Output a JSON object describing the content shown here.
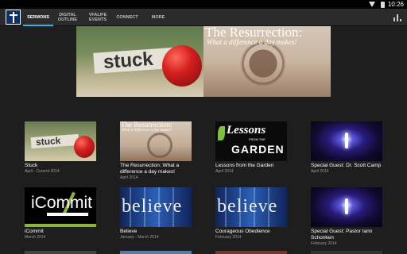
{
  "status_bar": {
    "time": "10:26"
  },
  "nav": {
    "tabs": [
      {
        "label": "SERMONS"
      },
      {
        "label": "DIGITAL OUTLINE"
      },
      {
        "label": "VFALIFE EVENTS"
      },
      {
        "label": "CONNECT"
      },
      {
        "label": "MORE"
      }
    ]
  },
  "hero": {
    "left_word": "stuck",
    "right_title": "The Resurrection:",
    "right_subtitle": "What a difference a day makes!"
  },
  "series": [
    {
      "title": "Stuck",
      "date": "April - Current 2014",
      "thumb": "stuck",
      "thumb_text": "stuck"
    },
    {
      "title": "The Resurrection: What a difference a day makes!",
      "date": "April 2014",
      "thumb": "resurrection",
      "thumb_text": "The Resurrection:",
      "thumb_sub": "What a difference a day makes!"
    },
    {
      "title": "Lessons from the Garden",
      "date": "April 2014",
      "thumb": "lessons",
      "thumb_text": "Lessons",
      "thumb_sub": "FROM THE",
      "thumb_text2": "GARDEN"
    },
    {
      "title": "Special Guest: Dr. Scott Camp",
      "date": "April 2014",
      "thumb": "light"
    },
    {
      "title": "iCommit",
      "date": "March 2014",
      "thumb": "icommit",
      "thumb_text": "iCommit"
    },
    {
      "title": "Believe",
      "date": "January - March 2014",
      "thumb": "believe",
      "thumb_text": "believe"
    },
    {
      "title": "Courageous Obedience",
      "date": "February 2014",
      "thumb": "believe",
      "thumb_text": "believe"
    },
    {
      "title": "Special Guest: Pastor Iann Schonken",
      "date": "February 2014",
      "thumb": "light"
    }
  ]
}
